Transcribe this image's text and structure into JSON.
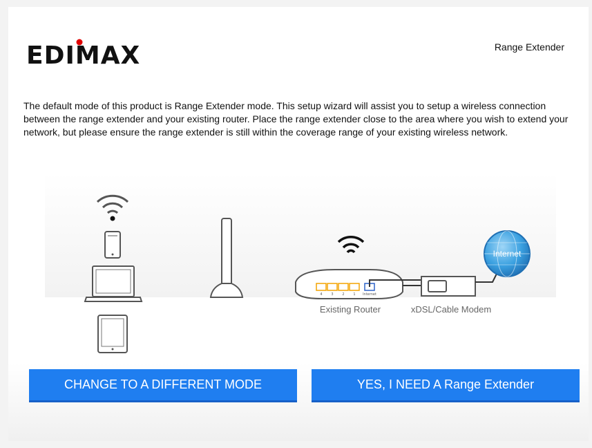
{
  "brand": {
    "logo_text": "EDIMAX",
    "logo_dot_color": "#e00000"
  },
  "header": {
    "product_name": "Range Extender"
  },
  "intro": {
    "text": "The default mode of this product is Range Extender mode. This setup wizard will assist you to setup a wireless connection between the range extender and your existing router. Place the range extender close to the area where you wish to extend your network, but please ensure the range extender is still within the coverage range of your existing wireless network."
  },
  "diagram": {
    "router_label": "Existing Router",
    "modem_label": "xDSL/Cable Modem",
    "internet_label": "Internet",
    "router_port_labels": [
      "4",
      "3",
      "2",
      "1",
      "Internet"
    ],
    "icons": [
      "wifi-icon",
      "smartphone-icon",
      "laptop-icon",
      "tablet-icon",
      "range-extender-icon",
      "router-icon",
      "modem-icon",
      "globe-icon"
    ]
  },
  "buttons": {
    "change_mode": "CHANGE TO A DIFFERENT MODE",
    "confirm": "YES, I NEED A Range Extender"
  },
  "colors": {
    "button_blue": "#1f7ef0",
    "port_orange": "#f4a300",
    "port_blue": "#2c62c9",
    "globe_blue": "#3aa0e0"
  }
}
